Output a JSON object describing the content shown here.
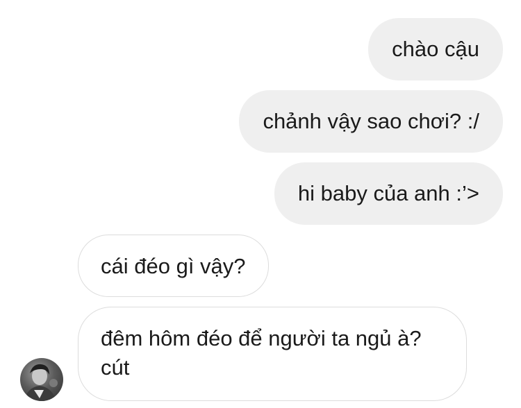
{
  "conversation": {
    "messages": [
      {
        "sender": "me",
        "text": "chào cậu"
      },
      {
        "sender": "me",
        "text": "chảnh vậy sao chơi? :/"
      },
      {
        "sender": "me",
        "text": "hi baby của anh :’>"
      },
      {
        "sender": "other",
        "text": "cái đéo gì vậy?"
      },
      {
        "sender": "other",
        "text": "đêm hôm đéo để người ta ngủ à? cút"
      }
    ]
  },
  "colors": {
    "sent_bubble": "#efefef",
    "received_border": "#dcdcdc",
    "text": "#1a1a1a"
  },
  "icons": {
    "avatar": "contact-avatar"
  }
}
